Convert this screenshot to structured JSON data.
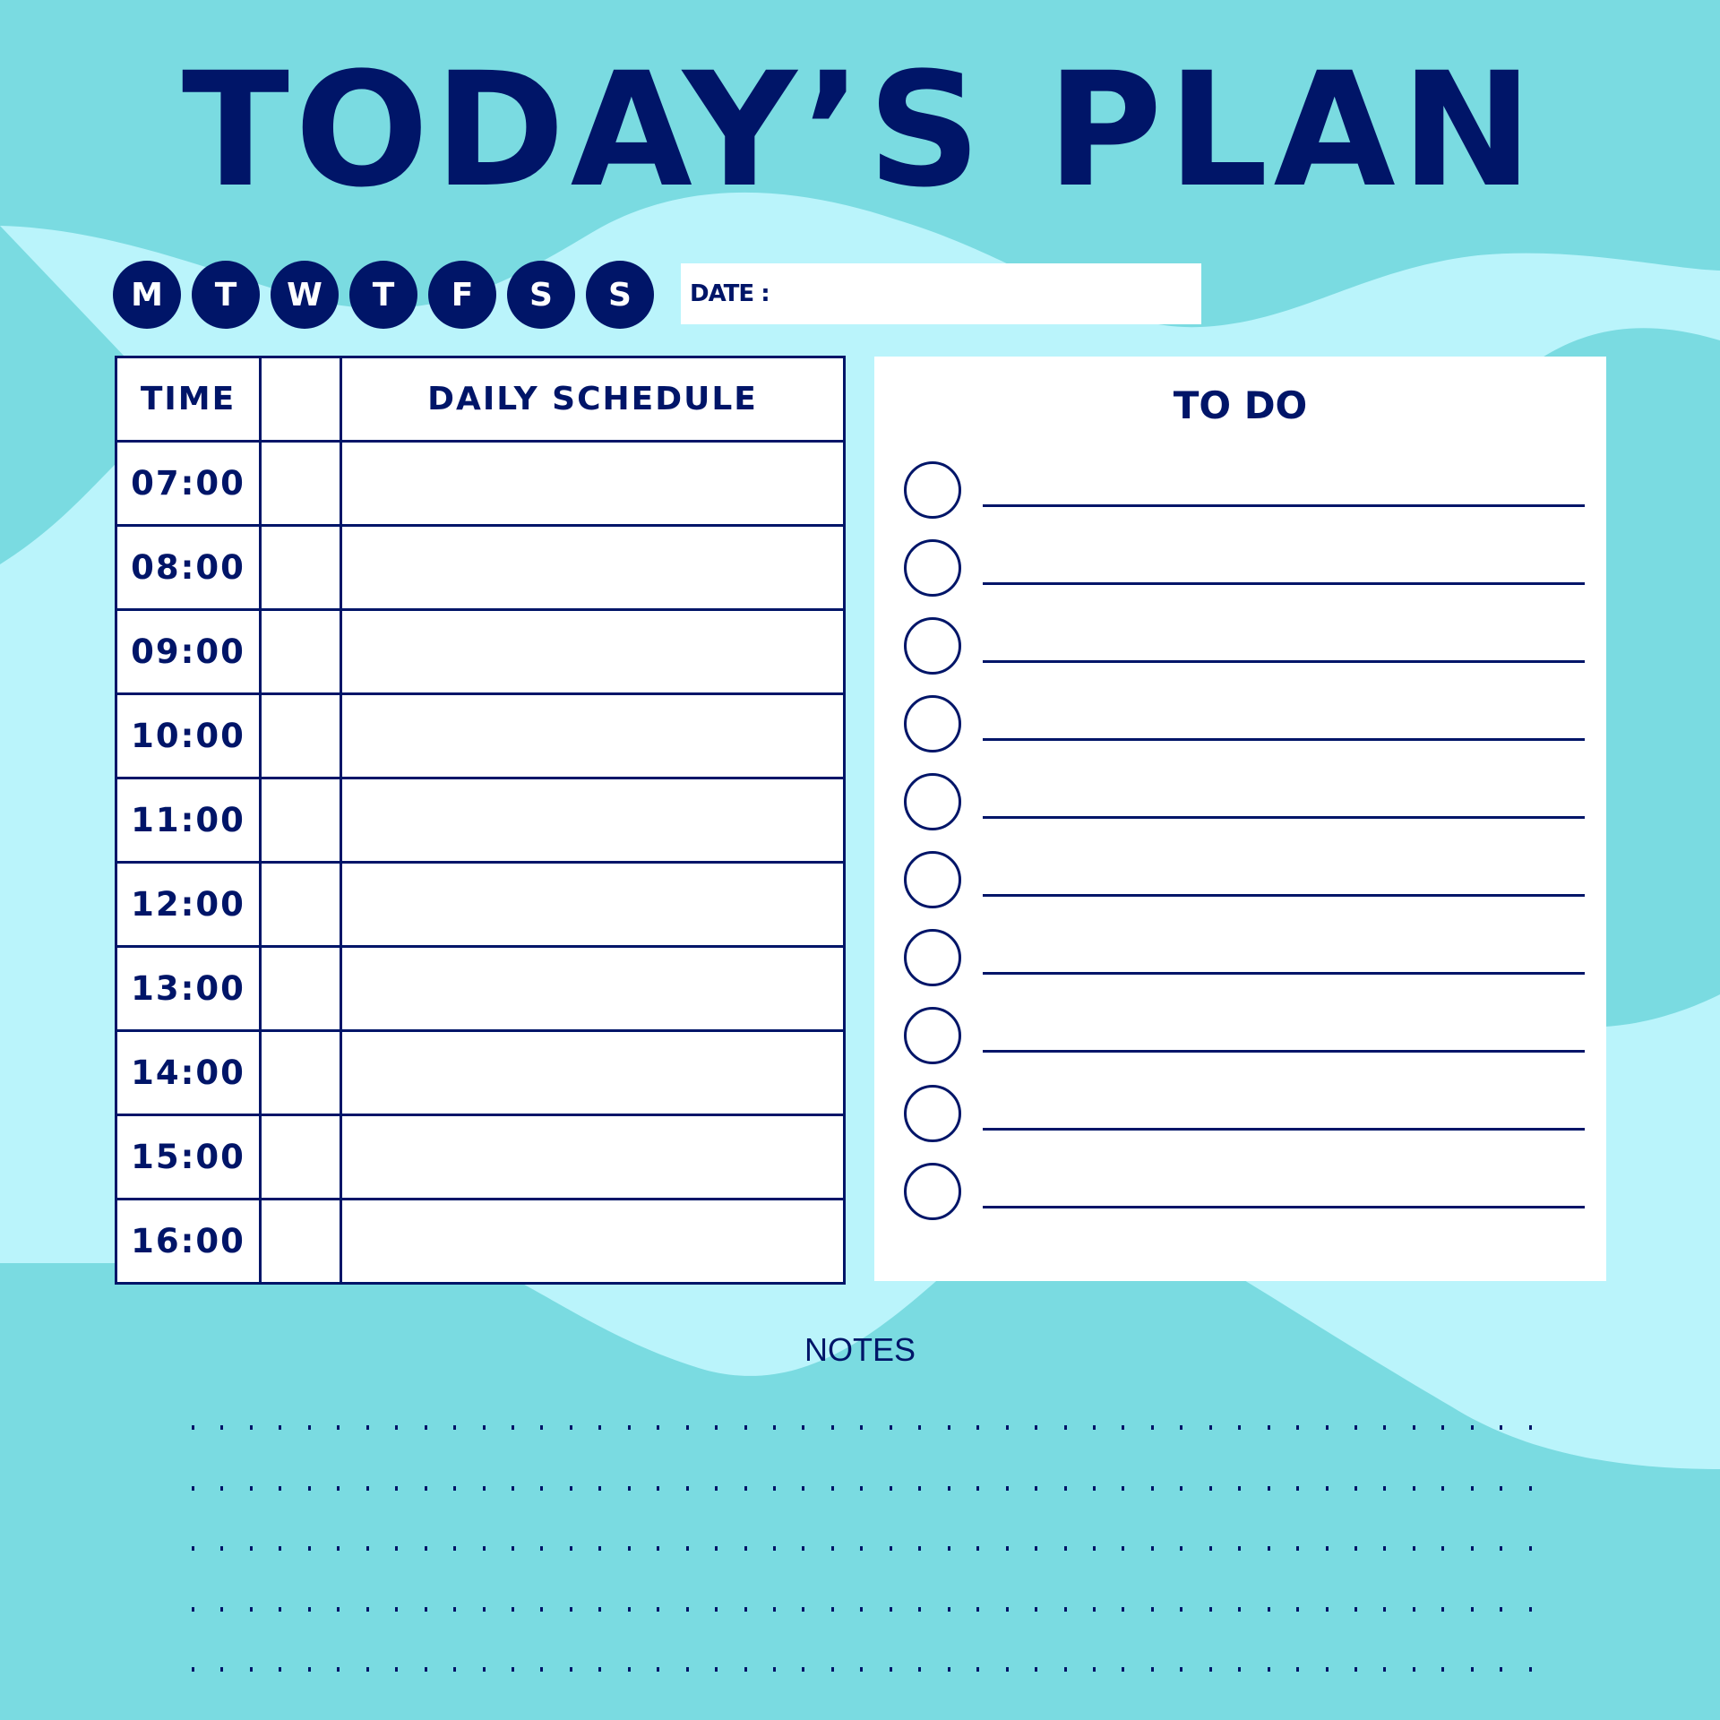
{
  "title": "TODAY’S PLAN",
  "colors": {
    "background": "#7adbe1",
    "wave_light": "#baf4fb",
    "navy": "#001568",
    "panel": "#ffffff"
  },
  "weekdays": [
    "M",
    "T",
    "W",
    "T",
    "F",
    "S",
    "S"
  ],
  "date": {
    "label": "DATE :",
    "value": ""
  },
  "schedule": {
    "headers": {
      "time": "TIME",
      "mark": "",
      "daily": "DAILY SCHEDULE"
    },
    "rows": [
      {
        "time": "07:00",
        "mark": "",
        "entry": ""
      },
      {
        "time": "08:00",
        "mark": "",
        "entry": ""
      },
      {
        "time": "09:00",
        "mark": "",
        "entry": ""
      },
      {
        "time": "10:00",
        "mark": "",
        "entry": ""
      },
      {
        "time": "11:00",
        "mark": "",
        "entry": ""
      },
      {
        "time": "12:00",
        "mark": "",
        "entry": ""
      },
      {
        "time": "13:00",
        "mark": "",
        "entry": ""
      },
      {
        "time": "14:00",
        "mark": "",
        "entry": ""
      },
      {
        "time": "15:00",
        "mark": "",
        "entry": ""
      },
      {
        "time": "16:00",
        "mark": "",
        "entry": ""
      }
    ]
  },
  "todo": {
    "title": "TO DO",
    "items": [
      {
        "checked": false,
        "text": ""
      },
      {
        "checked": false,
        "text": ""
      },
      {
        "checked": false,
        "text": ""
      },
      {
        "checked": false,
        "text": ""
      },
      {
        "checked": false,
        "text": ""
      },
      {
        "checked": false,
        "text": ""
      },
      {
        "checked": false,
        "text": ""
      },
      {
        "checked": false,
        "text": ""
      },
      {
        "checked": false,
        "text": ""
      },
      {
        "checked": false,
        "text": ""
      }
    ]
  },
  "notes": {
    "title": "NOTES",
    "dotted_lines": 5,
    "dots_per_line": 47
  }
}
